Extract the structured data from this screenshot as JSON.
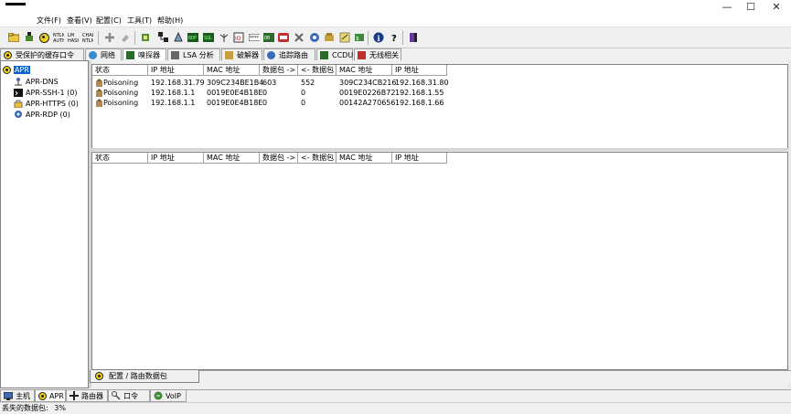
{
  "window": {
    "minimize": "—",
    "maximize": "☐",
    "close": "✕"
  },
  "menu": [
    "文件(F)",
    "查看(V)",
    "配置(C)",
    "工具(T)",
    "帮助(H)"
  ],
  "toolbar_icons": [
    "open-folder-icon",
    "plug-icon",
    "radiation-icon",
    "hash-icon",
    "hash-icon",
    "hash-icon",
    "plus-icon",
    "clear-icon",
    "scan-icon",
    "network-icon",
    "dos-icon",
    "sniffer-icon",
    "antenna-icon",
    "cisco-icon",
    "wifi-icon",
    "console-icon",
    "voip-icon",
    "base64-icon",
    "hash-calc-icon",
    "cert-icon",
    "wep-icon",
    "info-icon",
    "help-icon",
    "exit-icon"
  ],
  "top_tabs": [
    {
      "label": "受保护的缓存口令",
      "icon": "radiation-icon"
    },
    {
      "label": "网络",
      "icon": "globe-icon"
    },
    {
      "label": "嗅探器",
      "icon": "sniffer-icon"
    },
    {
      "label": "LSA 分析",
      "icon": "lsa-icon"
    },
    {
      "label": "破解器",
      "icon": "cracker-icon"
    },
    {
      "label": "追踪路由",
      "icon": "traceroute-icon"
    },
    {
      "label": "CCDU",
      "icon": "ccdu-icon"
    },
    {
      "label": "无线相关",
      "icon": "wireless-icon"
    }
  ],
  "tree": [
    {
      "label": "APR",
      "selected": true
    },
    {
      "label": "APR-DNS"
    },
    {
      "label": "APR-SSH-1 (0)"
    },
    {
      "label": "APR-HTTPS (0)"
    },
    {
      "label": "APR-RDP (0)"
    }
  ],
  "table": {
    "headers": [
      "状态",
      "IP 地址",
      "MAC 地址",
      "数据包 ->",
      "<- 数据包",
      "MAC 地址",
      "IP 地址"
    ],
    "rows": [
      [
        "Poisoning",
        "192.168.31.79",
        "309C234BE1B4",
        "603",
        "552",
        "309C234CB216",
        "192.168.31.80"
      ],
      [
        "Poisoning",
        "192.168.1.1",
        "0019E0E4B18E",
        "0",
        "0",
        "0019E0226B72",
        "192.168.1.55"
      ],
      [
        "Poisoning",
        "192.168.1.1",
        "0019E0E4B18E",
        "0",
        "0",
        "00142A270656",
        "192.168.1.66"
      ]
    ]
  },
  "table2": {
    "headers": [
      "状态",
      "IP 地址",
      "MAC 地址",
      "数据包 ->",
      "<- 数据包",
      "MAC 地址",
      "IP 地址"
    ]
  },
  "subtab": "配置 / 路由数据包",
  "bottom_tabs": [
    {
      "label": "主机",
      "icon": "host-icon"
    },
    {
      "label": "APR",
      "icon": "radiation-icon"
    },
    {
      "label": "路由器",
      "icon": "router-icon"
    },
    {
      "label": "口令",
      "icon": "password-icon"
    },
    {
      "label": "VoIP",
      "icon": "voip-icon"
    }
  ],
  "status": {
    "label": "丢失的数据包:",
    "value": "3%"
  },
  "colors": {
    "selection": "#0a64d0",
    "radiation_yellow": "#f2d21a"
  }
}
